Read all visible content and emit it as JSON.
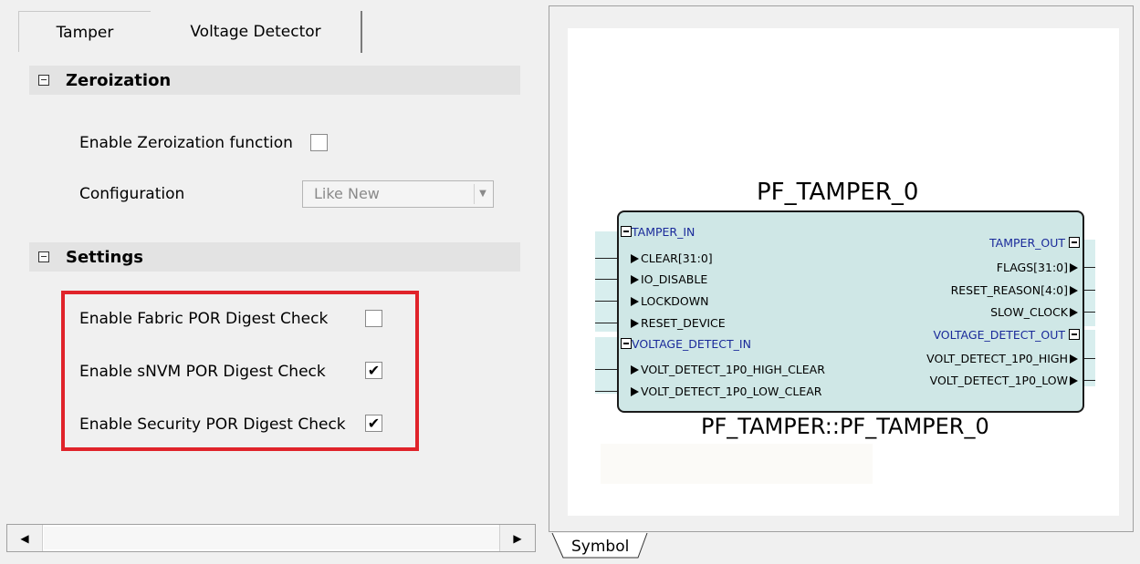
{
  "tabs": [
    {
      "label": "Tamper",
      "active": true
    },
    {
      "label": "Voltage Detector",
      "active": false
    }
  ],
  "zeroization": {
    "heading": "Zeroization",
    "enable_label": "Enable Zeroization function",
    "enable_checked": false,
    "config_label": "Configuration",
    "config_value": "Like New"
  },
  "settings": {
    "heading": "Settings",
    "items": [
      {
        "label": "Enable Fabric POR Digest Check",
        "checked": false
      },
      {
        "label": "Enable sNVM POR Digest Check",
        "checked": true
      },
      {
        "label": "Enable Security POR Digest Check",
        "checked": true
      }
    ]
  },
  "symbol": {
    "title": "PF_TAMPER_0",
    "subtitle": "PF_TAMPER::PF_TAMPER_0",
    "tab_label": "Symbol",
    "left_groups": [
      {
        "name": "TAMPER_IN",
        "pins": [
          "CLEAR[31:0]",
          "IO_DISABLE",
          "LOCKDOWN",
          "RESET_DEVICE"
        ]
      },
      {
        "name": "VOLTAGE_DETECT_IN",
        "pins": [
          "VOLT_DETECT_1P0_HIGH_CLEAR",
          "VOLT_DETECT_1P0_LOW_CLEAR"
        ]
      }
    ],
    "right_groups": [
      {
        "name": "TAMPER_OUT",
        "pins": [
          "FLAGS[31:0]",
          "RESET_REASON[4:0]",
          "SLOW_CLOCK"
        ]
      },
      {
        "name": "VOLTAGE_DETECT_OUT",
        "pins": [
          "VOLT_DETECT_1P0_HIGH",
          "VOLT_DETECT_1P0_LOW"
        ]
      }
    ]
  },
  "colors": {
    "highlight": "#e0232a",
    "symbol_fill": "#cfe7e6",
    "group_text": "#1a2a9a"
  }
}
